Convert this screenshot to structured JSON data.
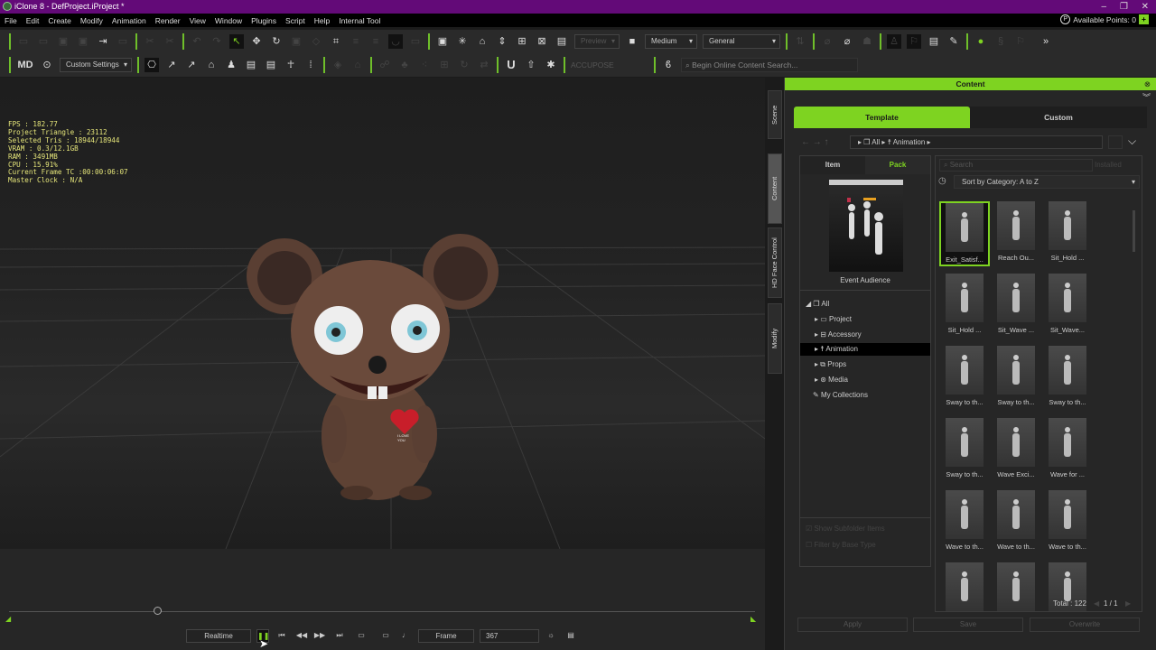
{
  "window": {
    "title": "iClone 8 - DefProject.iProject *",
    "min": "–",
    "max": "❐",
    "close": "✕"
  },
  "menu": [
    "File",
    "Edit",
    "Create",
    "Modify",
    "Animation",
    "Render",
    "View",
    "Window",
    "Plugins",
    "Script",
    "Help",
    "Internal Tool"
  ],
  "points": {
    "icon": "P",
    "label": "Available Points: 0",
    "plus": "+"
  },
  "toolbar1": {
    "preview": "Preview",
    "quality": "Medium",
    "mode": "General"
  },
  "toolbar2": {
    "settings": "Custom Settings",
    "accupose": "ACCUPOSE",
    "search_placeholder": "Begin Online Content Search..."
  },
  "stats": [
    "FPS : 182.77",
    "Project Triangle : 23112",
    "Selected Tris : 18944/18944",
    "VRAM : 0.3/12.1GB",
    "RAM : 3491MB",
    "CPU : 15.91%",
    "Current Frame TC :00:00:06:07",
    "Master Clock : N/A"
  ],
  "heart_text": "I LOVE YOU",
  "playback": {
    "realtime": "Realtime",
    "unit": "Frame",
    "frame": "367",
    "progress": 0.2
  },
  "side_tabs": [
    "Scene",
    "Content",
    "HD Face Control",
    "Modify"
  ],
  "content": {
    "title": "Content",
    "tabs": [
      "Template",
      "Custom"
    ],
    "breadcrumb": [
      "All",
      "Animation"
    ],
    "subtabs": [
      "Item",
      "Pack"
    ],
    "pack_name": "Event Audience",
    "tree": [
      "All",
      "Project",
      "Accessory",
      "Animation",
      "Props",
      "Media",
      "My Collections"
    ],
    "search_placeholder": "Search",
    "installed": "Installed",
    "sort": "Sort by Category: A to Z",
    "items": [
      "Exit_Satisf...",
      "Reach Ou...",
      "Sit_Hold ...",
      "Sit_Hold ...",
      "Sit_Wave ...",
      "Sit_Wave...",
      "Sway to th...",
      "Sway to th...",
      "Sway to th...",
      "Sway to th...",
      "Wave Exci...",
      "Wave for ...",
      "Wave to th...",
      "Wave to th...",
      "Wave to th...",
      "",
      "",
      ""
    ],
    "show_subfolder": "Show Subfolder Items",
    "filter_base": "Filter by Base Type",
    "total": "Total : 122",
    "page": "1  /  1",
    "buttons": [
      "Apply",
      "Save",
      "Overwrite"
    ]
  },
  "colors": {
    "accent": "#7ed321",
    "title": "#630a78"
  }
}
